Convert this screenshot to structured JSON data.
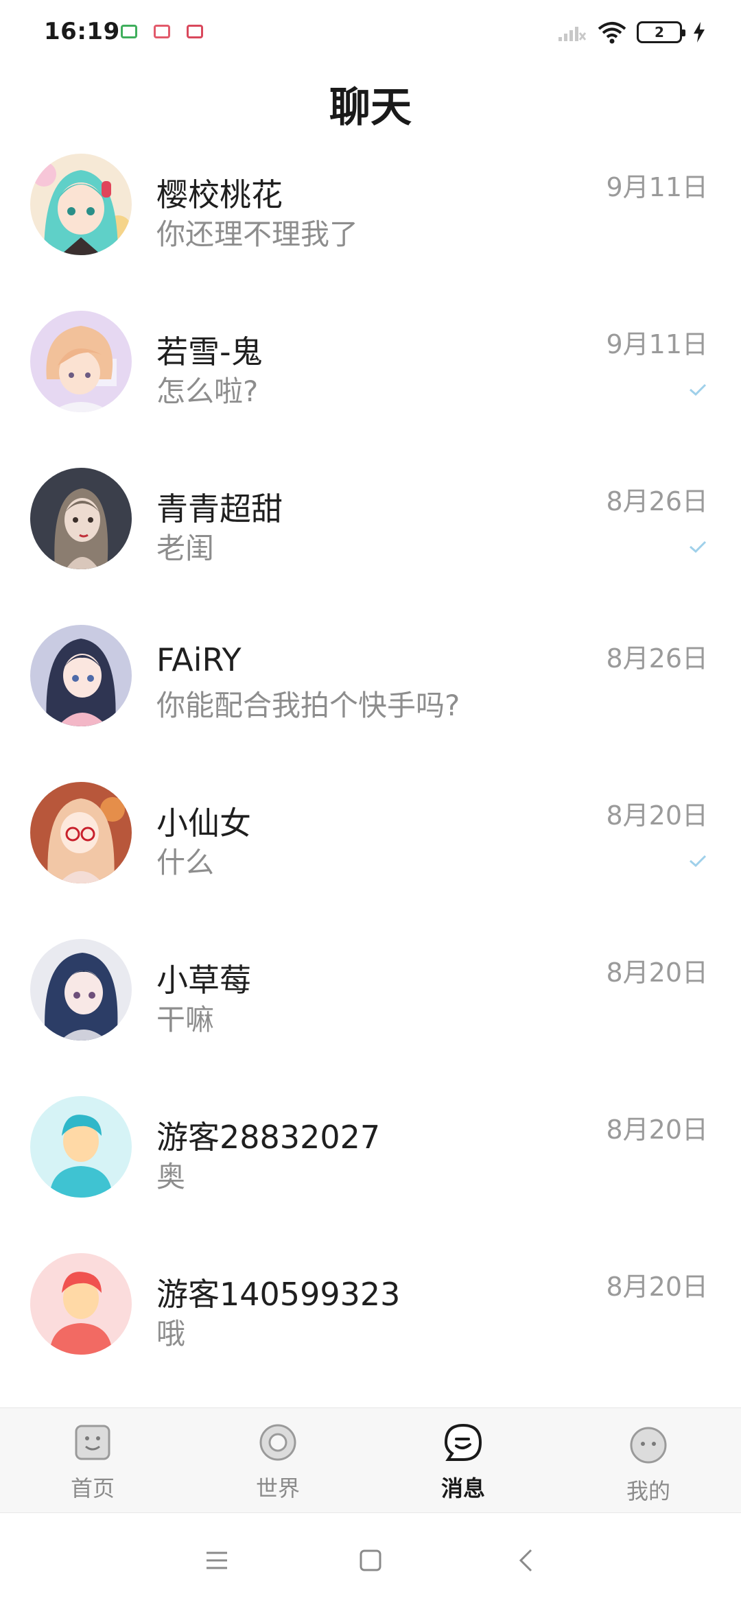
{
  "status_bar": {
    "time": "16:19",
    "battery": "2",
    "icons": [
      "signal-icon",
      "wifi-icon",
      "battery-icon",
      "charging-icon"
    ]
  },
  "header": {
    "title": "聊天"
  },
  "chats": [
    {
      "name": "樱校桃花",
      "message": "你还理不理我了",
      "date": "9月11日",
      "read": false,
      "avatar": "anime-girl-teal-hair"
    },
    {
      "name": "若雪-鬼",
      "message": "怎么啦?",
      "date": "9月11日",
      "read": true,
      "avatar": "anime-boy-blond"
    },
    {
      "name": "青青超甜",
      "message": "老闺",
      "date": "8月26日",
      "read": true,
      "avatar": "anime-girl-dark"
    },
    {
      "name": "FAiRY",
      "message": "你能配合我拍个快手吗?",
      "date": "8月26日",
      "read": false,
      "avatar": "anime-girl-pink-coat"
    },
    {
      "name": "小仙女",
      "message": "什么",
      "date": "8月20日",
      "read": true,
      "avatar": "anime-girl-glasses"
    },
    {
      "name": "小草莓",
      "message": "干嘛",
      "date": "8月20日",
      "read": false,
      "avatar": "anime-girl-navy-hair"
    },
    {
      "name": "游客28832027",
      "message": "奥",
      "date": "8月20日",
      "read": false,
      "avatar": "default-avatar-blue"
    },
    {
      "name": "游客140599323",
      "message": "哦",
      "date": "8月20日",
      "read": false,
      "avatar": "default-avatar-red"
    }
  ],
  "tabs": [
    {
      "label": "首页",
      "icon": "home-face-icon",
      "active": false
    },
    {
      "label": "世界",
      "icon": "world-ring-icon",
      "active": false
    },
    {
      "label": "消息",
      "icon": "message-bubble-icon",
      "active": true
    },
    {
      "label": "我的",
      "icon": "profile-face-icon",
      "active": false
    }
  ],
  "colors": {
    "accent": "#1a1a1a",
    "muted": "#8d8d8d",
    "check": "#9fd0ea"
  }
}
